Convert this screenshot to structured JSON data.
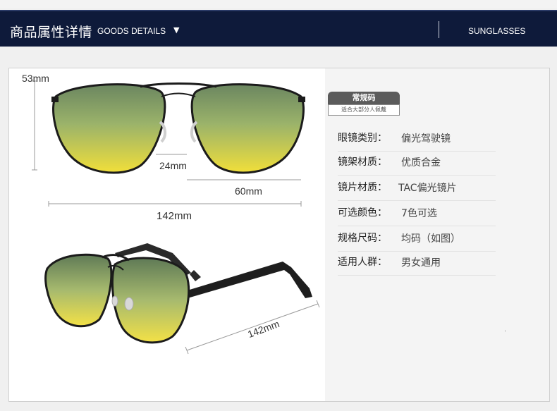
{
  "header": {
    "title_cn": "商品属性详情",
    "title_en": "GOODS DETAILS",
    "arrow": "▼",
    "category": "SUNGLASSES"
  },
  "dimensions": {
    "height": "53mm",
    "bridge": "24mm",
    "lens_width": "60mm",
    "total_width": "142mm",
    "temple_length": "142mm"
  },
  "badge": {
    "title": "常规码",
    "subtitle": "适合大部分人佩戴"
  },
  "specs": [
    {
      "label": "眼镜类别：",
      "value": "偏光驾驶镜"
    },
    {
      "label": "镜架材质：",
      "value": "优质合金"
    },
    {
      "label": "镜片材质：",
      "value": "TAC偏光镜片"
    },
    {
      "label": "可选颜色：",
      "value": "7色可选"
    },
    {
      "label": "规格尺码：",
      "value": "均码（如图）"
    },
    {
      "label": "适用人群：",
      "value": "男女通用"
    }
  ],
  "colors": {
    "header_bg": "#0e1a3a",
    "lens_top": "#6f8a62",
    "lens_bottom": "#f1df3a",
    "frame": "#1b1b1b"
  }
}
